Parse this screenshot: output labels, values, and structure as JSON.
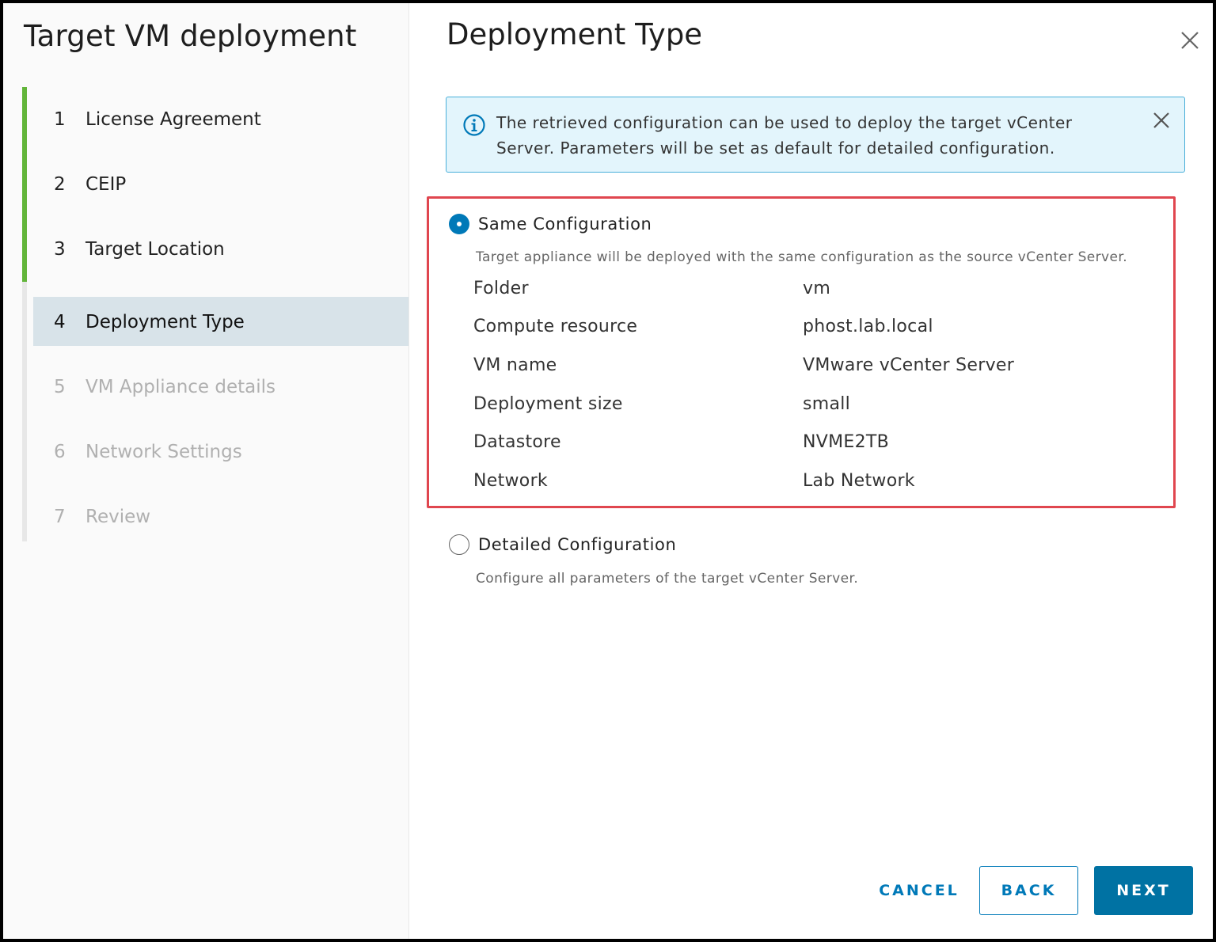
{
  "sidebar": {
    "title": "Target VM deployment",
    "steps": [
      {
        "num": "1",
        "label": "License Agreement"
      },
      {
        "num": "2",
        "label": "CEIP"
      },
      {
        "num": "3",
        "label": "Target Location"
      },
      {
        "num": "4",
        "label": "Deployment Type"
      },
      {
        "num": "5",
        "label": "VM Appliance details"
      },
      {
        "num": "6",
        "label": "Network Settings"
      },
      {
        "num": "7",
        "label": "Review"
      }
    ]
  },
  "main": {
    "title": "Deployment Type",
    "alert": {
      "text": "The retrieved configuration can be used to deploy the target vCenter Server. Parameters will be set as default for detailed configuration."
    },
    "options": {
      "same": {
        "label": "Same Configuration",
        "description": "Target appliance will be deployed with the same configuration as the source vCenter Server.",
        "selected": true
      },
      "detailed": {
        "label": "Detailed Configuration",
        "description": "Configure all parameters of the target vCenter Server.",
        "selected": false
      }
    },
    "properties": [
      {
        "key": "Folder",
        "value": "vm"
      },
      {
        "key": "Compute resource",
        "value": "phost.lab.local"
      },
      {
        "key": "VM name",
        "value": "VMware vCenter Server"
      },
      {
        "key": "Deployment size",
        "value": "small"
      },
      {
        "key": "Datastore",
        "value": "NVME2TB"
      },
      {
        "key": "Network",
        "value": "Lab Network"
      }
    ]
  },
  "footer": {
    "cancel_label": "CANCEL",
    "back_label": "BACK",
    "next_label": "NEXT"
  },
  "colors": {
    "accent": "#0079b8",
    "done_step": "#62b53a",
    "highlight_border": "#e0464f",
    "alert_bg": "#e3f5fc"
  }
}
